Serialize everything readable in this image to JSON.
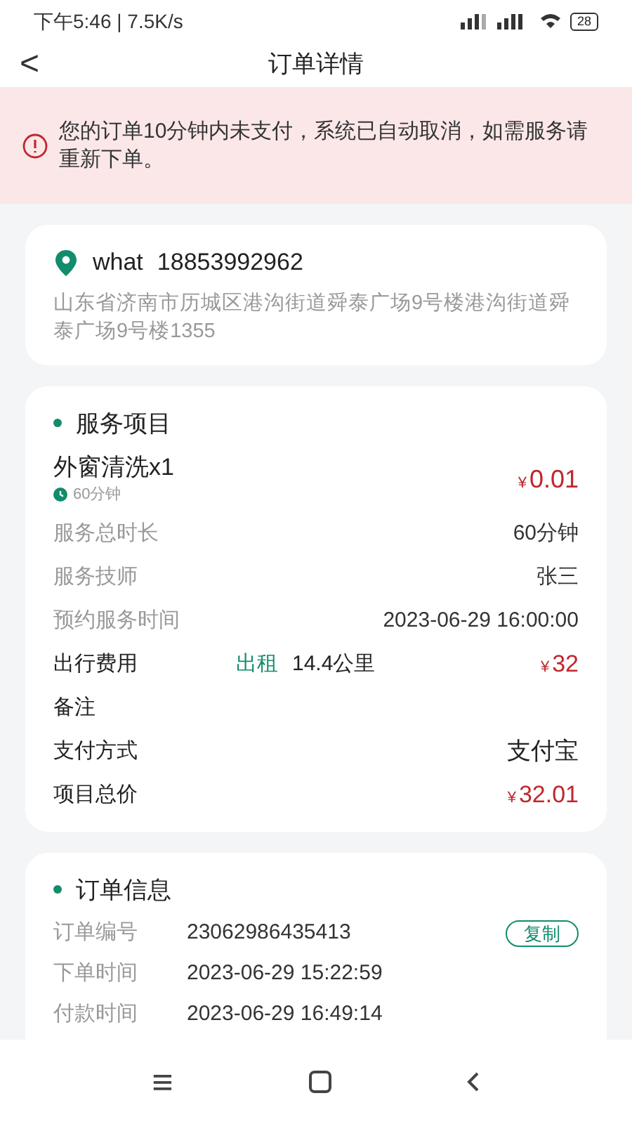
{
  "status_bar": {
    "time": "下午5:46 | 7.5K/s",
    "battery": "28"
  },
  "header": {
    "back": "<",
    "title": "订单详情"
  },
  "alert": {
    "text": "您的订单10分钟内未支付，系统已自动取消，如需服务请重新下单。"
  },
  "address": {
    "name": "what",
    "phone": "18853992962",
    "detail": "山东省济南市历城区港沟街道舜泰广场9号楼港沟街道舜泰广场9号楼1355"
  },
  "services": {
    "title": "服务项目",
    "rows": [
      {
        "kind": "item",
        "name": "外窗清洗x1",
        "duration": "60分钟",
        "symbol": "¥",
        "price": "0.01"
      },
      {
        "kind": "detail",
        "label": "服务总时长",
        "value": "60分钟"
      },
      {
        "kind": "detail",
        "label": "服务技师",
        "value": "张三"
      },
      {
        "kind": "detail",
        "label": "预约服务时间",
        "value": "2023-06-29 16:00:00"
      },
      {
        "kind": "travel",
        "label": "出行费用",
        "mode": "出租",
        "distance": "14.4公里",
        "symbol": "¥",
        "price": "32"
      },
      {
        "kind": "field",
        "label": "备注"
      },
      {
        "kind": "field",
        "label": "支付方式",
        "value": "支付宝"
      },
      {
        "kind": "total",
        "label": "项目总价",
        "symbol": "¥",
        "price": "32.01"
      }
    ]
  },
  "order_info": {
    "title": "订单信息",
    "rows": [
      {
        "label": "订单编号",
        "value": "23062986435413",
        "action": "复制"
      },
      {
        "label": "下单时间",
        "value": "2023-06-29 15:22:59"
      },
      {
        "label": "付款时间",
        "value": "2023-06-29 16:49:14"
      }
    ]
  },
  "nav_bar": {
    "menu": "≡"
  }
}
